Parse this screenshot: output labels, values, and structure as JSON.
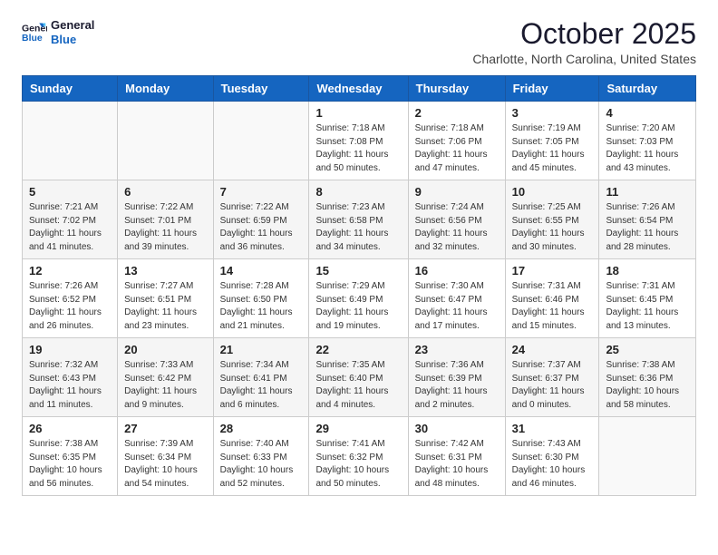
{
  "logo": {
    "line1": "General",
    "line2": "Blue"
  },
  "title": "October 2025",
  "location": "Charlotte, North Carolina, United States",
  "days_of_week": [
    "Sunday",
    "Monday",
    "Tuesday",
    "Wednesday",
    "Thursday",
    "Friday",
    "Saturday"
  ],
  "weeks": [
    [
      {
        "day": "",
        "sunrise": "",
        "sunset": "",
        "daylight": ""
      },
      {
        "day": "",
        "sunrise": "",
        "sunset": "",
        "daylight": ""
      },
      {
        "day": "",
        "sunrise": "",
        "sunset": "",
        "daylight": ""
      },
      {
        "day": "1",
        "sunrise": "Sunrise: 7:18 AM",
        "sunset": "Sunset: 7:08 PM",
        "daylight": "Daylight: 11 hours and 50 minutes."
      },
      {
        "day": "2",
        "sunrise": "Sunrise: 7:18 AM",
        "sunset": "Sunset: 7:06 PM",
        "daylight": "Daylight: 11 hours and 47 minutes."
      },
      {
        "day": "3",
        "sunrise": "Sunrise: 7:19 AM",
        "sunset": "Sunset: 7:05 PM",
        "daylight": "Daylight: 11 hours and 45 minutes."
      },
      {
        "day": "4",
        "sunrise": "Sunrise: 7:20 AM",
        "sunset": "Sunset: 7:03 PM",
        "daylight": "Daylight: 11 hours and 43 minutes."
      }
    ],
    [
      {
        "day": "5",
        "sunrise": "Sunrise: 7:21 AM",
        "sunset": "Sunset: 7:02 PM",
        "daylight": "Daylight: 11 hours and 41 minutes."
      },
      {
        "day": "6",
        "sunrise": "Sunrise: 7:22 AM",
        "sunset": "Sunset: 7:01 PM",
        "daylight": "Daylight: 11 hours and 39 minutes."
      },
      {
        "day": "7",
        "sunrise": "Sunrise: 7:22 AM",
        "sunset": "Sunset: 6:59 PM",
        "daylight": "Daylight: 11 hours and 36 minutes."
      },
      {
        "day": "8",
        "sunrise": "Sunrise: 7:23 AM",
        "sunset": "Sunset: 6:58 PM",
        "daylight": "Daylight: 11 hours and 34 minutes."
      },
      {
        "day": "9",
        "sunrise": "Sunrise: 7:24 AM",
        "sunset": "Sunset: 6:56 PM",
        "daylight": "Daylight: 11 hours and 32 minutes."
      },
      {
        "day": "10",
        "sunrise": "Sunrise: 7:25 AM",
        "sunset": "Sunset: 6:55 PM",
        "daylight": "Daylight: 11 hours and 30 minutes."
      },
      {
        "day": "11",
        "sunrise": "Sunrise: 7:26 AM",
        "sunset": "Sunset: 6:54 PM",
        "daylight": "Daylight: 11 hours and 28 minutes."
      }
    ],
    [
      {
        "day": "12",
        "sunrise": "Sunrise: 7:26 AM",
        "sunset": "Sunset: 6:52 PM",
        "daylight": "Daylight: 11 hours and 26 minutes."
      },
      {
        "day": "13",
        "sunrise": "Sunrise: 7:27 AM",
        "sunset": "Sunset: 6:51 PM",
        "daylight": "Daylight: 11 hours and 23 minutes."
      },
      {
        "day": "14",
        "sunrise": "Sunrise: 7:28 AM",
        "sunset": "Sunset: 6:50 PM",
        "daylight": "Daylight: 11 hours and 21 minutes."
      },
      {
        "day": "15",
        "sunrise": "Sunrise: 7:29 AM",
        "sunset": "Sunset: 6:49 PM",
        "daylight": "Daylight: 11 hours and 19 minutes."
      },
      {
        "day": "16",
        "sunrise": "Sunrise: 7:30 AM",
        "sunset": "Sunset: 6:47 PM",
        "daylight": "Daylight: 11 hours and 17 minutes."
      },
      {
        "day": "17",
        "sunrise": "Sunrise: 7:31 AM",
        "sunset": "Sunset: 6:46 PM",
        "daylight": "Daylight: 11 hours and 15 minutes."
      },
      {
        "day": "18",
        "sunrise": "Sunrise: 7:31 AM",
        "sunset": "Sunset: 6:45 PM",
        "daylight": "Daylight: 11 hours and 13 minutes."
      }
    ],
    [
      {
        "day": "19",
        "sunrise": "Sunrise: 7:32 AM",
        "sunset": "Sunset: 6:43 PM",
        "daylight": "Daylight: 11 hours and 11 minutes."
      },
      {
        "day": "20",
        "sunrise": "Sunrise: 7:33 AM",
        "sunset": "Sunset: 6:42 PM",
        "daylight": "Daylight: 11 hours and 9 minutes."
      },
      {
        "day": "21",
        "sunrise": "Sunrise: 7:34 AM",
        "sunset": "Sunset: 6:41 PM",
        "daylight": "Daylight: 11 hours and 6 minutes."
      },
      {
        "day": "22",
        "sunrise": "Sunrise: 7:35 AM",
        "sunset": "Sunset: 6:40 PM",
        "daylight": "Daylight: 11 hours and 4 minutes."
      },
      {
        "day": "23",
        "sunrise": "Sunrise: 7:36 AM",
        "sunset": "Sunset: 6:39 PM",
        "daylight": "Daylight: 11 hours and 2 minutes."
      },
      {
        "day": "24",
        "sunrise": "Sunrise: 7:37 AM",
        "sunset": "Sunset: 6:37 PM",
        "daylight": "Daylight: 11 hours and 0 minutes."
      },
      {
        "day": "25",
        "sunrise": "Sunrise: 7:38 AM",
        "sunset": "Sunset: 6:36 PM",
        "daylight": "Daylight: 10 hours and 58 minutes."
      }
    ],
    [
      {
        "day": "26",
        "sunrise": "Sunrise: 7:38 AM",
        "sunset": "Sunset: 6:35 PM",
        "daylight": "Daylight: 10 hours and 56 minutes."
      },
      {
        "day": "27",
        "sunrise": "Sunrise: 7:39 AM",
        "sunset": "Sunset: 6:34 PM",
        "daylight": "Daylight: 10 hours and 54 minutes."
      },
      {
        "day": "28",
        "sunrise": "Sunrise: 7:40 AM",
        "sunset": "Sunset: 6:33 PM",
        "daylight": "Daylight: 10 hours and 52 minutes."
      },
      {
        "day": "29",
        "sunrise": "Sunrise: 7:41 AM",
        "sunset": "Sunset: 6:32 PM",
        "daylight": "Daylight: 10 hours and 50 minutes."
      },
      {
        "day": "30",
        "sunrise": "Sunrise: 7:42 AM",
        "sunset": "Sunset: 6:31 PM",
        "daylight": "Daylight: 10 hours and 48 minutes."
      },
      {
        "day": "31",
        "sunrise": "Sunrise: 7:43 AM",
        "sunset": "Sunset: 6:30 PM",
        "daylight": "Daylight: 10 hours and 46 minutes."
      },
      {
        "day": "",
        "sunrise": "",
        "sunset": "",
        "daylight": ""
      }
    ]
  ]
}
